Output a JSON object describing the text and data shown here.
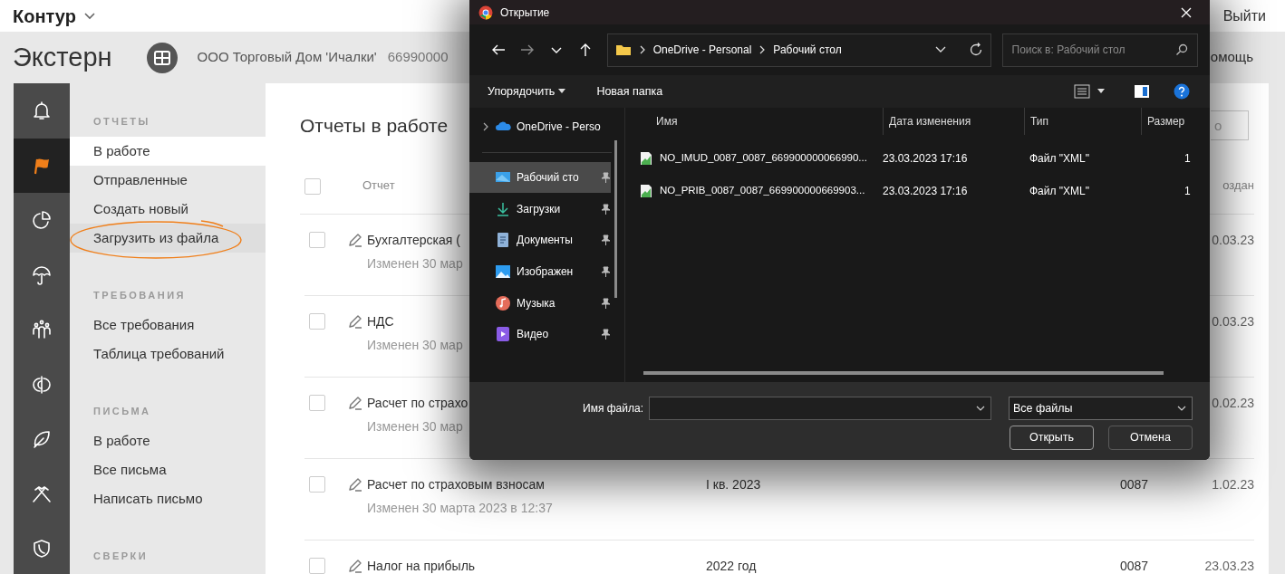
{
  "topbar": {
    "brand": "Контур",
    "logout": "Выйти"
  },
  "header": {
    "product": "Экстерн",
    "org_name": "ООО Торговый Дом 'Ичалки'",
    "org_inn": "66990000",
    "help": "омощь"
  },
  "rail": [
    {
      "kind": "bell",
      "selected": false
    },
    {
      "kind": "flag",
      "selected": true
    },
    {
      "kind": "pie",
      "selected": false
    },
    {
      "kind": "umbrella",
      "selected": false
    },
    {
      "kind": "people",
      "selected": false
    },
    {
      "kind": "halfcircle",
      "selected": false
    },
    {
      "kind": "leaf",
      "selected": false
    },
    {
      "kind": "tools",
      "selected": false
    },
    {
      "kind": "shield",
      "selected": false
    }
  ],
  "nav": [
    {
      "heading": "ОТЧЕТЫ",
      "items": [
        {
          "label": "В работе",
          "selected": true,
          "circled": false
        },
        {
          "label": "Отправленные",
          "selected": false,
          "circled": false
        },
        {
          "label": "Создать новый",
          "selected": false,
          "circled": false
        },
        {
          "label": "Загрузить из файла",
          "selected": false,
          "circled": true
        }
      ]
    },
    {
      "heading": "ТРЕБОВАНИЯ",
      "items": [
        {
          "label": "Все требования",
          "selected": false,
          "circled": false
        },
        {
          "label": "Таблица требований",
          "selected": false,
          "circled": false
        }
      ]
    },
    {
      "heading": "ПИСЬМА",
      "items": [
        {
          "label": "В работе",
          "selected": false,
          "circled": false
        },
        {
          "label": "Все письма",
          "selected": false,
          "circled": false
        },
        {
          "label": "Написать письмо",
          "selected": false,
          "circled": false
        }
      ]
    },
    {
      "heading": "СВЕРКИ"
    }
  ],
  "main": {
    "title": "Отчеты в работе",
    "search_placeholder": "о",
    "select_all_checked": false,
    "columns": [
      "Отчет",
      "оздан"
    ],
    "rows": [
      {
        "checked": false,
        "title": "Бухгалтерская (",
        "modified": "Изменен 30 мар",
        "created": "0.03.23"
      },
      {
        "checked": false,
        "title": "НДС",
        "modified": "Изменен 30 мар",
        "created": "0.03.23"
      },
      {
        "checked": false,
        "title": "Расчет по страхо",
        "modified": "Изменен 30 мар",
        "created": "0.02.23"
      },
      {
        "checked": false,
        "title": "Расчет по страховым взносам",
        "modified": "Изменен 30 марта 2023 в 12:37",
        "period": "I кв. 2023",
        "code": "0087",
        "created": "1.02.23"
      },
      {
        "checked": false,
        "title": "Налог на прибыль",
        "period": "2022 год",
        "code": "0087",
        "created": "23.03.23"
      }
    ]
  },
  "dialog": {
    "title": "Открытие",
    "path": [
      "OneDrive - Personal",
      "Рабочий стол"
    ],
    "search_placeholder": "Поиск в: Рабочий стол",
    "organize": "Упорядочить",
    "new_folder": "Новая папка",
    "nav": [
      {
        "kind": "cloud",
        "label": "OneDrive - Perso",
        "selected": false,
        "pinned": false,
        "expandable": true
      },
      {
        "kind": "desktop",
        "label": "Рабочий сто",
        "selected": true,
        "pinned": true,
        "expandable": false
      },
      {
        "kind": "download",
        "label": "Загрузки",
        "selected": false,
        "pinned": true,
        "expandable": false
      },
      {
        "kind": "document",
        "label": "Документы",
        "selected": false,
        "pinned": true,
        "expandable": false
      },
      {
        "kind": "image",
        "label": "Изображен",
        "selected": false,
        "pinned": true,
        "expandable": false
      },
      {
        "kind": "music",
        "label": "Музыка",
        "selected": false,
        "pinned": true,
        "expandable": false
      },
      {
        "kind": "video",
        "label": "Видео",
        "selected": false,
        "pinned": true,
        "expandable": false
      }
    ],
    "columns": [
      "Имя",
      "Дата изменения",
      "Тип",
      "Размер"
    ],
    "files": [
      {
        "name": "NO_IMUD_0087_0087_669900000066990...",
        "modified": "23.03.2023 17:16",
        "type": "Файл \"XML\"",
        "size": "1"
      },
      {
        "name": "NO_PRIB_0087_0087_669900000669903...",
        "modified": "23.03.2023 17:16",
        "type": "Файл \"XML\"",
        "size": "1"
      }
    ],
    "filename_label": "Имя файла:",
    "filter": "Все файлы",
    "buttons": [
      {
        "label": "Открыть",
        "default": true
      },
      {
        "label": "Отмена",
        "default": false
      }
    ]
  }
}
